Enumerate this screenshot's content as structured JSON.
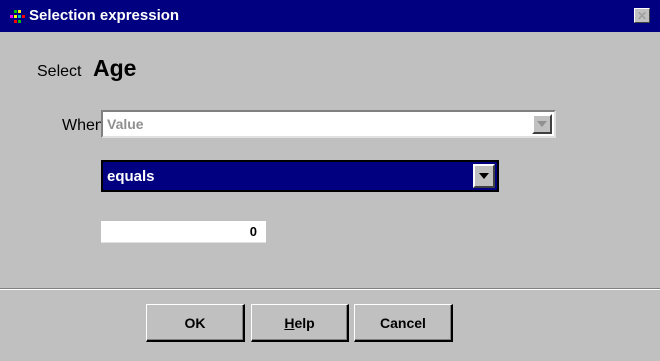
{
  "window": {
    "title": "Selection expression",
    "icon": "app-grid-icon",
    "close_icon": "close-icon"
  },
  "form": {
    "select_label": "Select",
    "select_field": "Age",
    "when_label": "When",
    "when_value": "Value",
    "operator_value": "equals",
    "input_value": "0"
  },
  "buttons": {
    "ok": "OK",
    "help_mnemonic": "H",
    "help_rest": "elp",
    "cancel": "Cancel"
  },
  "colors": {
    "titlebar": "#000080",
    "dialog_bg": "#c0c0c0",
    "selected_combo": "#000080"
  }
}
